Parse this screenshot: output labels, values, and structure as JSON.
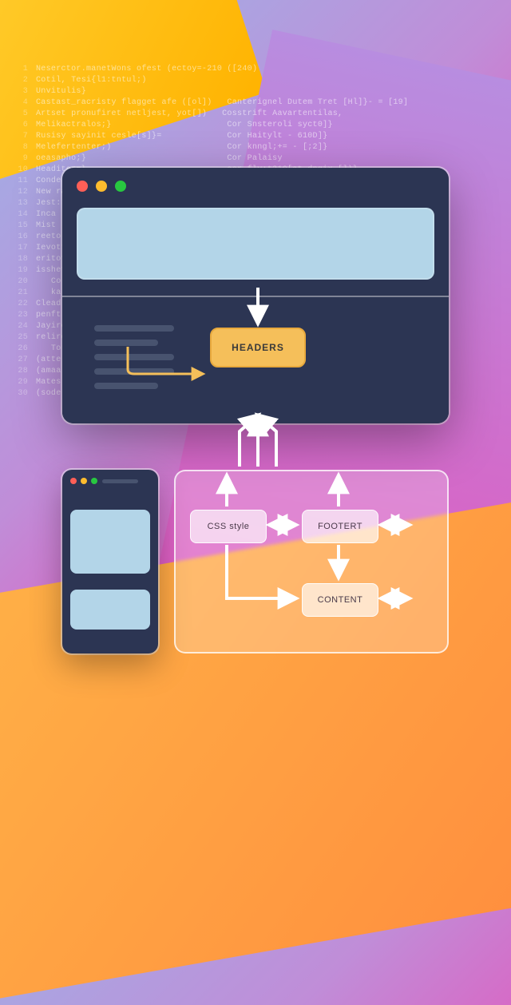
{
  "background_code": [
    "Neserctor.manetWons ofest (ectoy=-210 ([240)",
    "Cotil, Tesi{l1:tntul;)",
    "Unvitulis}",
    "Castast_racristy flagget afe ([ol])   Canterignel Dutem Tret [Hl]}- = [19]",
    "Artset pronufiret netljest, yot[])   Cosstrift Aavartentilas,",
    "Melikactralos;}                       Cor Snsteroli syct0]}",
    "Rusisy sayinit cesle[s]}=             Cor Haitylt - 610D]}",
    "Melefertenter;)                       Cor knngl;+= - [;2]}",
    "oeasapho;}                            Cor Palaisy",
    "Headiter=}                            cor flv:t310[at dpgix-[])}",
    "Condertang(i=eterine letiler)         Cor Navtgarilowar {.rood[1]}",
    "New ra",
    "Jest:",
    "Inca",
    "Mist",
    "reeto",
    "Ievott",
    "eritof",
    "isshef",
    "   Co",
    "   ka",
    "Clead",
    "penft",
    "Jayiro",
    "relird",
    "   Tort",
    "(atte:",
    "(amaa-",
    "Mates",
    "(sode;"
  ],
  "browser": {
    "traffic": {
      "red": "#ff5f57",
      "yellow": "#febc2e",
      "green": "#28c840"
    }
  },
  "nodes": {
    "headers": "HEADERS",
    "css": "CSS style",
    "footer": "FOOTERT",
    "content": "CONTENT"
  },
  "colors": {
    "window_bg": "#2c3553",
    "accent_box": "#f5bf5a",
    "pale_blue": "#b3d5e8"
  }
}
